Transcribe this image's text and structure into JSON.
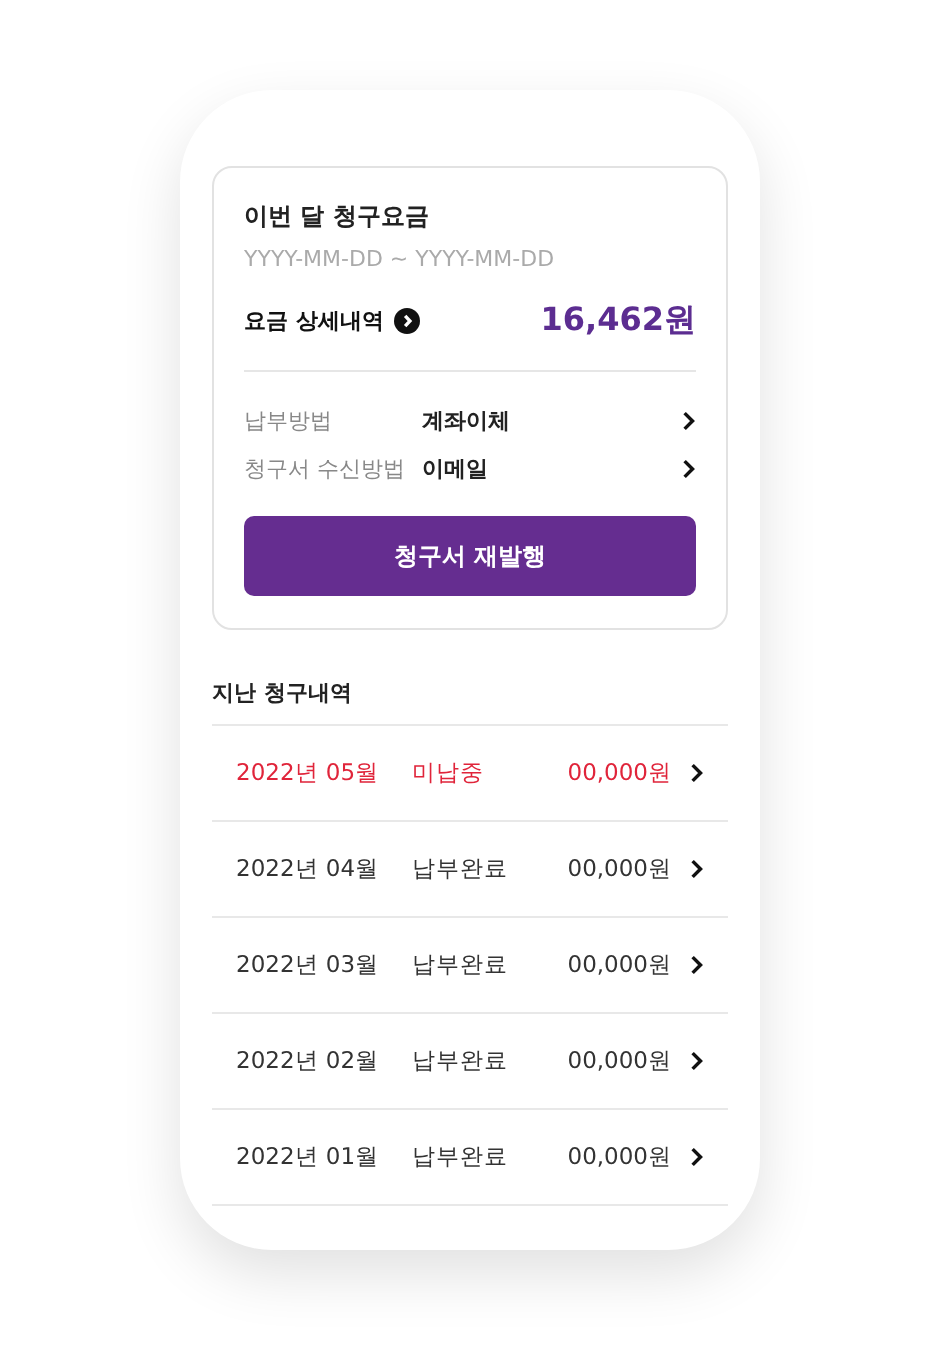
{
  "bill": {
    "title": "이번 달 청구요금",
    "period": "YYYY-MM-DD ~ YYYY-MM-DD",
    "detail_label": "요금 상세내역",
    "amount": "16,462원",
    "settings": [
      {
        "label": "납부방법",
        "value": "계좌이체"
      },
      {
        "label": "청구서 수신방법",
        "value": "이메일"
      }
    ],
    "button": "청구서 재발행"
  },
  "history": {
    "title": "지난 청구내역",
    "rows": [
      {
        "month": "2022년 05월",
        "status": "미납중",
        "amount": "00,000원",
        "overdue": true
      },
      {
        "month": "2022년 04월",
        "status": "납부완료",
        "amount": "00,000원",
        "overdue": false
      },
      {
        "month": "2022년 03월",
        "status": "납부완료",
        "amount": "00,000원",
        "overdue": false
      },
      {
        "month": "2022년 02월",
        "status": "납부완료",
        "amount": "00,000원",
        "overdue": false
      },
      {
        "month": "2022년 01월",
        "status": "납부완료",
        "amount": "00,000원",
        "overdue": false
      }
    ]
  }
}
